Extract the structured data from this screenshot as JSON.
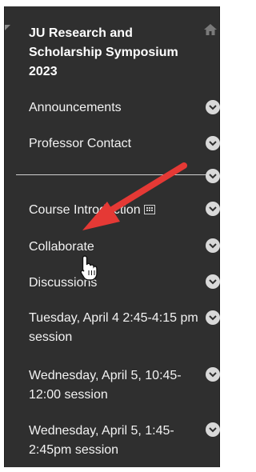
{
  "course": {
    "title": "JU Research and Scholarship Symposium 2023"
  },
  "menu": {
    "items": [
      {
        "label": "Announcements"
      },
      {
        "label": "Professor Contact"
      },
      {
        "label": "Course Introduction"
      },
      {
        "label": "Collaborate"
      },
      {
        "label": "Discussions"
      },
      {
        "label": "Tuesday, April 4 2:45-4:15 pm session"
      },
      {
        "label": "Wednesday, April 5, 10:45-12:00 session"
      },
      {
        "label": "Wednesday, April 5, 1:45-2:45pm session"
      }
    ]
  },
  "annotation": {
    "arrow_color": "#e53935"
  },
  "icons": {
    "home": "home-icon",
    "menu_chevron": "chevron-down-circle-icon",
    "pointer": "hand-pointer-cursor-icon",
    "external": "external-link-icon"
  }
}
